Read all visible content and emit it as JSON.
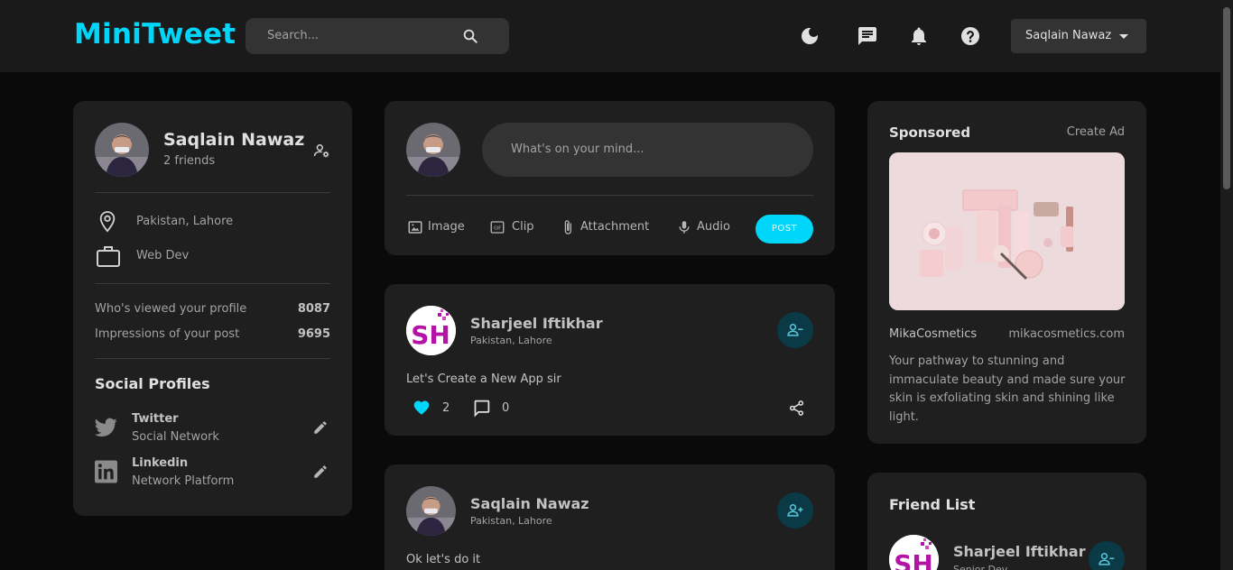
{
  "brand": {
    "logo": "MiniTweet"
  },
  "nav": {
    "search_placeholder": "Search...",
    "user_name": "Saqlain Nawaz"
  },
  "profile": {
    "name": "Saqlain Nawaz",
    "friends": "2 friends",
    "location": "Pakistan, Lahore",
    "occupation": "Web Dev",
    "stats": [
      {
        "label": "Who's viewed your profile",
        "value": "8087"
      },
      {
        "label": "Impressions of your post",
        "value": "9695"
      }
    ],
    "social_title": "Social Profiles",
    "social": [
      {
        "name": "Twitter",
        "sub": "Social Network"
      },
      {
        "name": "Linkedin",
        "sub": "Network Platform"
      }
    ]
  },
  "composer": {
    "placeholder": "What's on your mind...",
    "tools": [
      "Image",
      "Clip",
      "Attachment",
      "Audio"
    ],
    "post_label": "POST"
  },
  "posts": [
    {
      "name": "Sharjeel Iftikhar",
      "location": "Pakistan, Lahore",
      "text": "Let's Create a New App sir",
      "likes": "2",
      "comments": "0"
    },
    {
      "name": "Saqlain Nawaz",
      "location": "Pakistan, Lahore",
      "text": "Ok let's do it"
    }
  ],
  "sponsored": {
    "title": "Sponsored",
    "create_ad": "Create Ad",
    "brand": "MikaCosmetics",
    "site": "mikacosmetics.com",
    "description": "Your pathway to stunning and immaculate beauty and made sure your skin is exfoliating skin and shining like light."
  },
  "friend_list": {
    "title": "Friend List",
    "friends": [
      {
        "name": "Sharjeel Iftikhar",
        "role": "Senior Dev"
      }
    ]
  },
  "colors": {
    "accent": "#00d5fa",
    "bg": "#0a0a0a",
    "card": "#1f1f1f",
    "navbar": "#1a1a1a",
    "heart": "#00d5fa"
  }
}
